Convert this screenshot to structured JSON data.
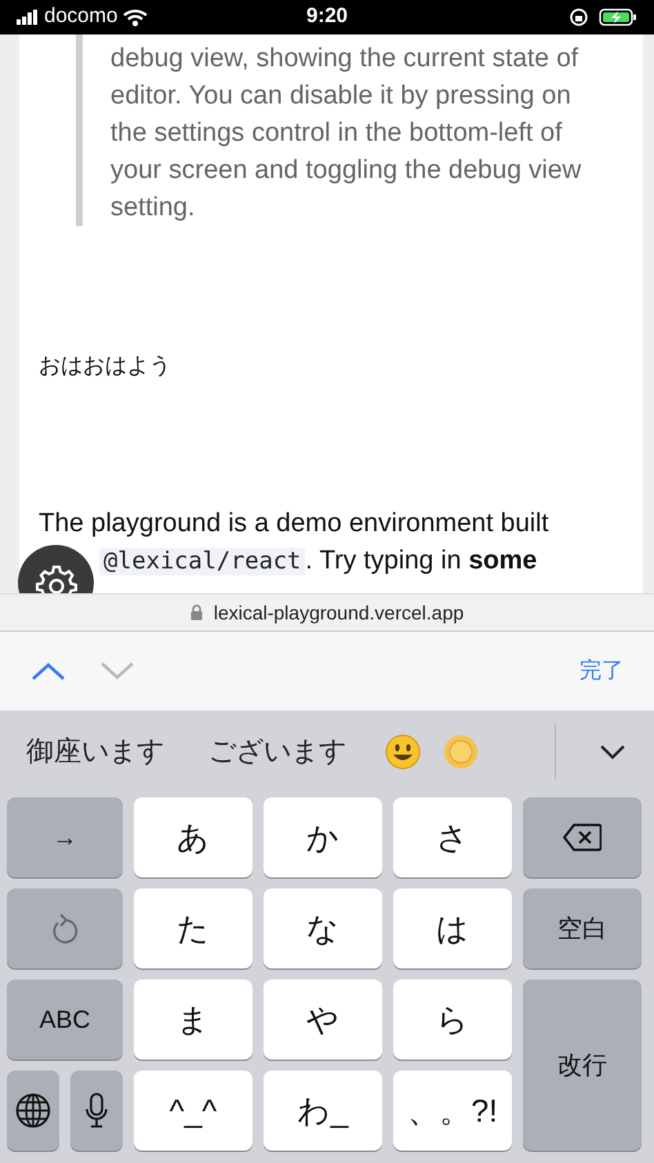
{
  "status_bar": {
    "carrier": "docomo",
    "time": "9:20"
  },
  "blockquote": {
    "text": "debug view, showing the current state of editor. You can disable it by pressing on the settings control in the bottom-left of your screen and toggling the debug view setting."
  },
  "paragraphs": [
    {
      "segments": [
        {
          "kind": "text",
          "text": "おはおはよう"
        }
      ]
    },
    {
      "segments": [
        {
          "kind": "text",
          "text": "The playground is a demo environment built"
        },
        {
          "kind": "break"
        },
        {
          "kind": "code",
          "text": "@lexical/react"
        },
        {
          "kind": "text",
          "text": ". Try typing in **some**"
        }
      ]
    }
  ],
  "url_bar": {
    "url": "lexical-playground.vercel.app"
  },
  "form_toolbar": {
    "previous_disabled": false,
    "next_disabled": true,
    "done": "完了"
  },
  "candidates": [
    {
      "kind": "text",
      "text": "御座います"
    },
    {
      "kind": "text",
      "text": "ございます"
    },
    {
      "kind": "smiley"
    },
    {
      "kind": "sun"
    }
  ],
  "keyboard_rows": [
    [
      {
        "kind": "function",
        "label": "→"
      },
      {
        "kind": "letter",
        "label": "あ"
      },
      {
        "kind": "letter",
        "label": "か"
      },
      {
        "kind": "letter",
        "label": "さ"
      },
      {
        "kind": "backspace"
      }
    ],
    [
      {
        "kind": "undo"
      },
      {
        "kind": "letter",
        "label": "た"
      },
      {
        "kind": "letter",
        "label": "な"
      },
      {
        "kind": "letter",
        "label": "は"
      },
      {
        "kind": "function",
        "label": "空白"
      }
    ],
    [
      {
        "kind": "function",
        "label": "ABC"
      },
      {
        "kind": "letter",
        "label": "ま"
      },
      {
        "kind": "letter",
        "label": "や"
      },
      {
        "kind": "letter",
        "label": "ら"
      },
      {
        "kind": "return",
        "label": "改行"
      }
    ],
    [
      {
        "kind": "globe"
      },
      {
        "kind": "mic"
      },
      {
        "kind": "letter",
        "label": "^_^"
      },
      {
        "kind": "letter",
        "label": "わ_"
      },
      {
        "kind": "letter",
        "label": "、。?!"
      }
    ]
  ]
}
